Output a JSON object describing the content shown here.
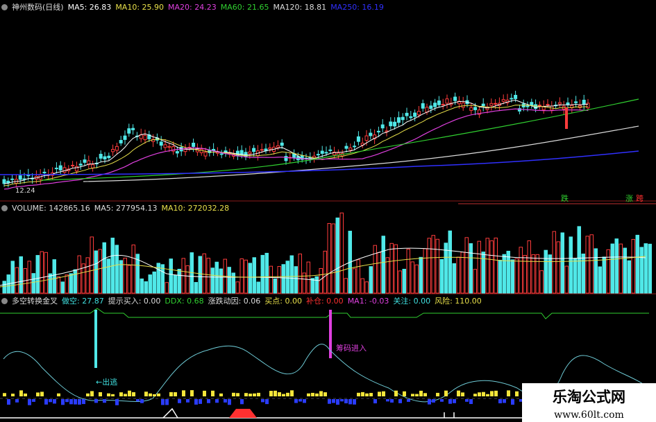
{
  "price_panel": {
    "name": "神州数码(日线)",
    "indicators": [
      {
        "label": "MA5: 26.83",
        "color": "#ffffff"
      },
      {
        "label": "MA10: 25.90",
        "color": "#e8e04a"
      },
      {
        "label": "MA20: 24.23",
        "color": "#e040e0"
      },
      {
        "label": "MA60: 21.65",
        "color": "#30d030"
      },
      {
        "label": "MA120: 18.81",
        "color": "#dddddd"
      },
      {
        "label": "MA250: 16.19",
        "color": "#3030ff"
      }
    ],
    "low_label": "12.24",
    "badges": {
      "fall": "跌",
      "rise_a": "涨",
      "rise_b": "跨"
    }
  },
  "volume_panel": {
    "indicators": [
      {
        "label": "VOLUME: 142865.16",
        "color": "#dddddd"
      },
      {
        "label": "MA5: 277954.13",
        "color": "#dddddd"
      },
      {
        "label": "MA10: 272032.28",
        "color": "#e8e04a"
      }
    ]
  },
  "signal_panel": {
    "indicators": [
      {
        "label": "多空转换金叉",
        "color": "#dddddd"
      },
      {
        "label": "做空: 27.87",
        "color": "#40e0e0"
      },
      {
        "label": "提示买入: 0.00",
        "color": "#dddddd"
      },
      {
        "label": "DDX: 0.68",
        "color": "#30d030"
      },
      {
        "label": "涨跌动因: 0.06",
        "color": "#dddddd"
      },
      {
        "label": "买点: 0.00",
        "color": "#e8e04a"
      },
      {
        "label": "补仓: 0.00",
        "color": "#ff3030"
      },
      {
        "label": "MA1: -0.03",
        "color": "#e040e0"
      },
      {
        "label": "关注: 0.00",
        "color": "#40e0e0"
      },
      {
        "label": "风险: 110.00",
        "color": "#e8e04a"
      }
    ],
    "exit_label": "←出逃",
    "enter_label": "筹码进入"
  },
  "watermark": {
    "title": "乐淘公式网",
    "url": "www.60lt.com"
  },
  "colors": {
    "up": "#ff3c3c",
    "down": "#50e8e8",
    "bg": "#000000"
  }
}
